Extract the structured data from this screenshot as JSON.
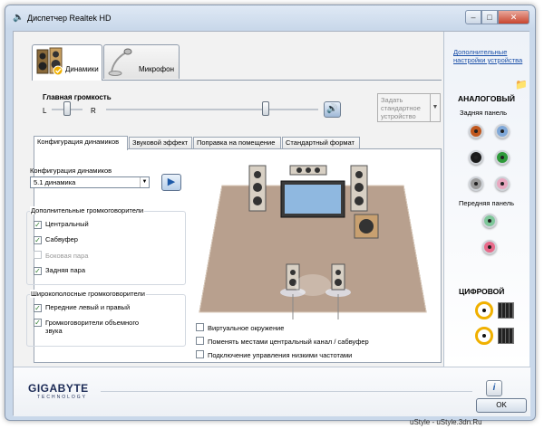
{
  "window": {
    "title": "Диспетчер Realtek HD"
  },
  "device_tabs": [
    {
      "label": "Динамики",
      "icon": "speakers-icon",
      "active": true
    },
    {
      "label": "Микрофон",
      "icon": "microphone-icon",
      "active": false
    }
  ],
  "volume": {
    "label": "Главная громкость",
    "left": "L",
    "right": "R",
    "balance": 0.5,
    "level": 0.75
  },
  "default_device": {
    "label": "Задать стандартное устройство"
  },
  "sub_tabs": [
    "Конфигурация динамиков",
    "Звуковой эффект",
    "Поправка на помещение",
    "Стандартный формат"
  ],
  "config": {
    "label": "Конфигурация динамиков",
    "selected": "5.1 динамика"
  },
  "optional": {
    "title": "Дополнительные громкоговорители",
    "items": [
      {
        "label": "Центральный",
        "checked": true,
        "disabled": false
      },
      {
        "label": "Сабвуфер",
        "checked": true,
        "disabled": false
      },
      {
        "label": "Боковая пара",
        "checked": false,
        "disabled": true
      },
      {
        "label": "Задняя пара",
        "checked": true,
        "disabled": false
      }
    ]
  },
  "fullrange": {
    "title": "Широкополосные громкоговорители",
    "items": [
      {
        "label": "Передние левый и правый",
        "checked": true
      },
      {
        "label": "Громкоговорители объемного звука",
        "checked": true
      }
    ]
  },
  "options": [
    {
      "label": "Виртуальное окружение",
      "checked": false
    },
    {
      "label": "Поменять местами центральный канал / сабвуфер",
      "checked": false
    },
    {
      "label": "Подключение управления низкими частотами",
      "checked": false
    }
  ],
  "right_panel": {
    "advanced_link": "Дополнительные настройки устройства",
    "analog_title": "АНАЛОГОВЫЙ",
    "rear_panel": "Задняя панель",
    "front_panel": "Передняя панель",
    "digital_title": "ЦИФРОВОЙ",
    "rear_jacks": [
      "#c0581e",
      "#7fa8d8",
      "#1a1a1a",
      "#2e9a3a",
      "#9a9a9a",
      "#e8a8c0"
    ],
    "front_jacks": [
      "#7fc79a",
      "#e86a8a"
    ]
  },
  "bottom": {
    "brand": "GIGABYTE",
    "brand_sub": "TECHNOLOGY",
    "ok": "OK"
  },
  "watermark": "uStyle - uStyle.3dn.Ru"
}
